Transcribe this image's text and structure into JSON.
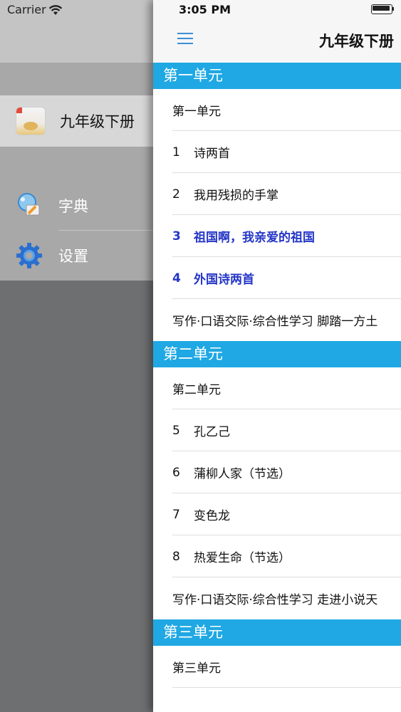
{
  "status": {
    "carrier": "Carrier",
    "time": "3:05 PM"
  },
  "drawer": {
    "book": {
      "title": "九年级下册",
      "icon": "book-cover-icon"
    },
    "menu": [
      {
        "label": "字典",
        "icon": "dictionary-icon"
      },
      {
        "label": "设置",
        "icon": "gear-icon"
      }
    ]
  },
  "header": {
    "title": "九年级下册",
    "menu_icon": "hamburger-icon"
  },
  "sections": [
    {
      "title": "第一单元",
      "rows": [
        {
          "num": "",
          "label": "第一单元"
        },
        {
          "num": "1",
          "label": "诗两首"
        },
        {
          "num": "2",
          "label": "我用残损的手掌"
        },
        {
          "num": "3",
          "label": "祖国啊，我亲爱的祖国"
        },
        {
          "num": "4",
          "label": "外国诗两首"
        },
        {
          "num": "",
          "label": "写作·口语交际·综合性学习 脚踏一方土"
        }
      ]
    },
    {
      "title": "第二单元",
      "rows": [
        {
          "num": "",
          "label": "第二单元"
        },
        {
          "num": "5",
          "label": "孔乙己"
        },
        {
          "num": "6",
          "label": "蒲柳人家（节选）"
        },
        {
          "num": "7",
          "label": "变色龙"
        },
        {
          "num": "8",
          "label": "热爱生命（节选）"
        },
        {
          "num": "",
          "label": "写作·口语交际·综合性学习 走进小说天"
        }
      ]
    },
    {
      "title": "第三单元",
      "rows": [
        {
          "num": "",
          "label": "第三单元"
        }
      ]
    }
  ],
  "colors": {
    "section_header": "#1fa8e3",
    "highlight_text": "#2536c7",
    "menu_button": "#3a8fd8"
  }
}
